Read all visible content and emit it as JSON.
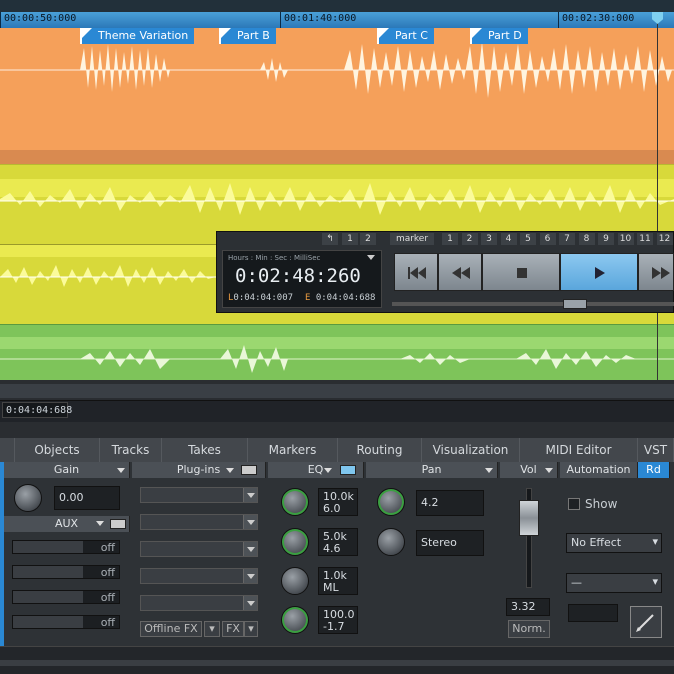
{
  "timeline": {
    "ruler_labels": [
      "00:00:50:000",
      "00:01:40:000",
      "00:02:30:000"
    ],
    "markers": [
      "Theme Variation",
      "Part B",
      "Part C",
      "Part D"
    ]
  },
  "status": {
    "position": "0:04:04:688"
  },
  "transport": {
    "undo_label": "↰",
    "left_nums": [
      "1",
      "2"
    ],
    "marker_label": "marker",
    "marker_nums": [
      "1",
      "2",
      "3",
      "4",
      "5",
      "6",
      "7",
      "8",
      "9",
      "10",
      "11",
      "12"
    ],
    "counter_format": "Hours : Min : Sec : MilliSec",
    "counter_time": "0:02:48:260",
    "left_prefix": "L",
    "left_time": "0:04:04:007",
    "end_prefix": "E",
    "end_time": "0:04:04:688",
    "buttons": [
      "rewind-start",
      "rewind",
      "stop",
      "play",
      "fast-forward"
    ]
  },
  "tabs": [
    "Objects",
    "Tracks",
    "Takes",
    "Markers",
    "Routing",
    "Visualization",
    "MIDI Editor",
    "VST"
  ],
  "mixer": {
    "gain": {
      "header": "Gain",
      "value": "0.00"
    },
    "aux": {
      "header": "AUX",
      "sends": [
        "off",
        "off",
        "off",
        "off"
      ]
    },
    "plugins": {
      "header": "Plug-ins",
      "offline_fx": "Offline FX",
      "fx": "FX"
    },
    "eq": {
      "header": "EQ",
      "bands": [
        {
          "freq": "10.0k",
          "gain": "6.0"
        },
        {
          "freq": "5.0k",
          "gain": "4.6"
        },
        {
          "freq": "1.0k",
          "gain": "ML"
        },
        {
          "freq": "100.0",
          "gain": "-1.7"
        }
      ]
    },
    "pan": {
      "header": "Pan",
      "value": "4.2",
      "mode": "Stereo"
    },
    "vol": {
      "header": "Vol",
      "value": "3.32",
      "norm": "Norm."
    },
    "automation": {
      "header": "Automation",
      "rd": "Rd",
      "show": "Show",
      "effect": "No Effect",
      "param": "—"
    }
  },
  "colors": {
    "accent": "#2a88d4",
    "track1": "#f5a05a",
    "track2": "#d8d93a",
    "track4": "#7ec45a"
  }
}
